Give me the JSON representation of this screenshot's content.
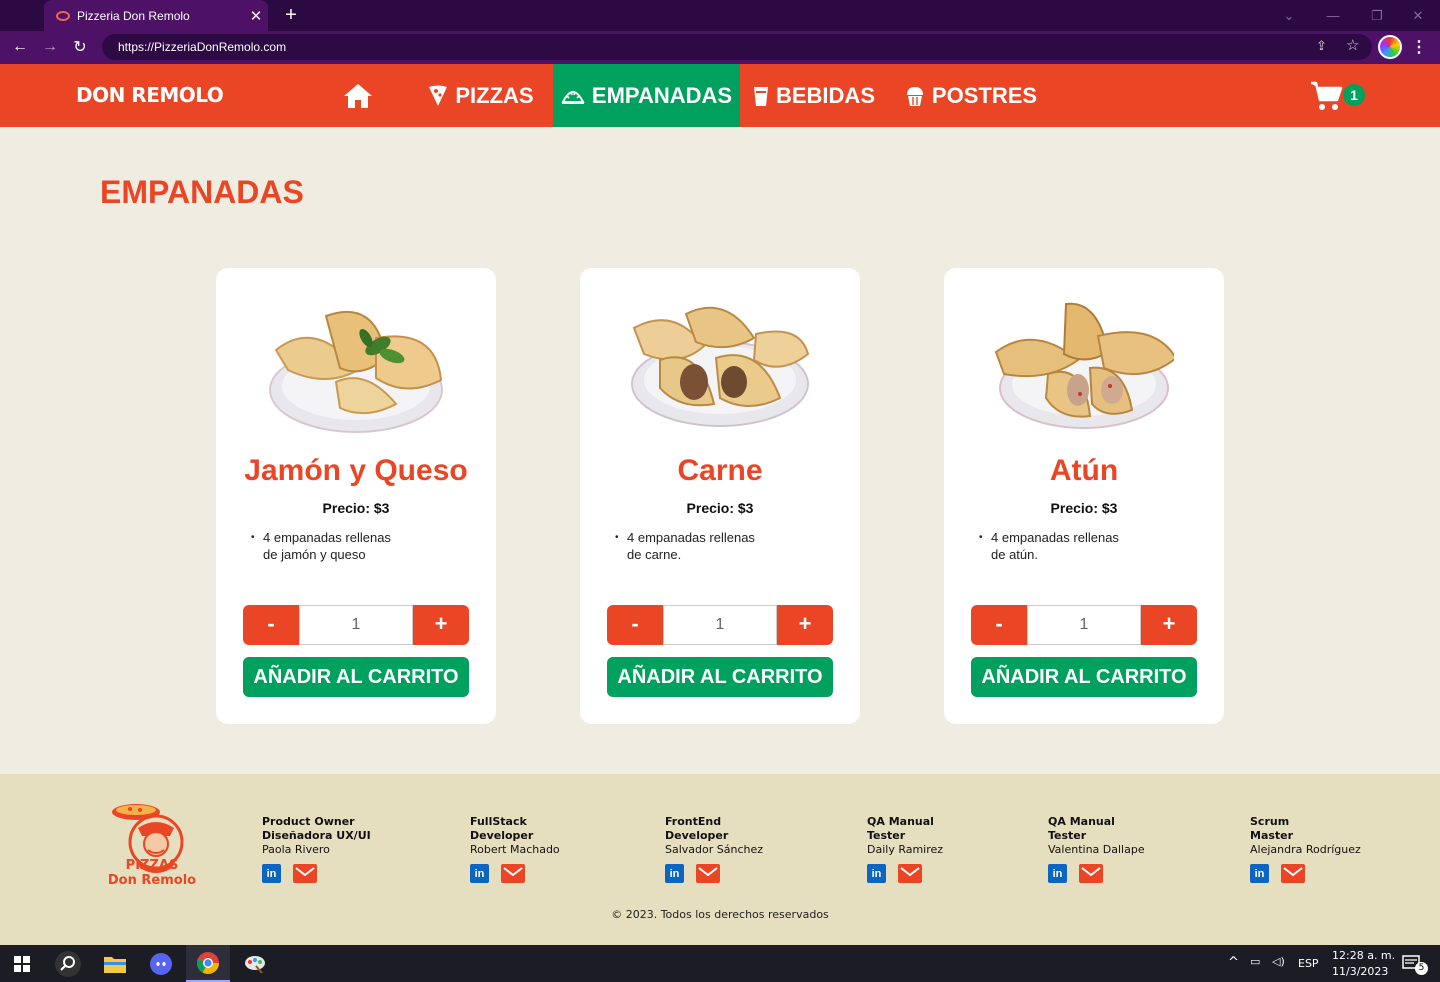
{
  "browser": {
    "tab_title": "Pizzeria Don Remolo",
    "tab_close": "✕",
    "new_tab": "+",
    "url": "https://PizzeriaDonRemolo.com"
  },
  "header": {
    "brand": "DON REMOLO",
    "nav": [
      {
        "label": "",
        "icon": "home-icon"
      },
      {
        "label": "PIZZAS",
        "icon": "pizza-slice-icon"
      },
      {
        "label": "EMPANADAS",
        "icon": "empanada-icon",
        "active": true
      },
      {
        "label": "BEBIDAS",
        "icon": "cup-icon"
      },
      {
        "label": "POSTRES",
        "icon": "cupcake-icon"
      }
    ],
    "cart_count": "1"
  },
  "main": {
    "title": "EMPANADAS",
    "products": [
      {
        "name": "Jamón y Queso",
        "price": "Precio: $3",
        "desc_line1": "4 empanadas rellenas",
        "desc_line2": "de jamón y queso",
        "qty": "1",
        "minus": "-",
        "plus": "+",
        "add": "AÑADIR AL CARRITO"
      },
      {
        "name": "Carne",
        "price": "Precio: $3",
        "desc_line1": "4 empanadas rellenas",
        "desc_line2": "de carne.",
        "qty": "1",
        "minus": "-",
        "plus": "+",
        "add": "AÑADIR AL CARRITO"
      },
      {
        "name": "Atún",
        "price": "Precio: $3",
        "desc_line1": "4 empanadas rellenas",
        "desc_line2": "de atún.",
        "qty": "1",
        "minus": "-",
        "plus": "+",
        "add": "AÑADIR AL CARRITO"
      }
    ]
  },
  "footer": {
    "logo_line1": "PIZZAS",
    "logo_line2": "Don Remolo",
    "team": [
      {
        "role": "Product Owner\nDiseñadora UX/UI",
        "name": "Paola Rivero"
      },
      {
        "role": "FullStack\nDeveloper",
        "name": "Robert Machado"
      },
      {
        "role": "FrontEnd\nDeveloper",
        "name": "Salvador Sánchez"
      },
      {
        "role": "QA Manual\nTester",
        "name": "Daily Ramirez"
      },
      {
        "role": "QA Manual\nTester",
        "name": "Valentina Dallape"
      },
      {
        "role": "Scrum\nMaster",
        "name": "Alejandra Rodríguez"
      }
    ],
    "linkedin_label": "in",
    "copyright": "© 2023. Todos los derechos reservados"
  },
  "taskbar": {
    "lang": "ESP",
    "time": "12:28 a. m.",
    "date": "11/3/2023",
    "notifications": "5"
  },
  "colors": {
    "brand_red": "#ea4626",
    "brand_green": "#00a05e",
    "page_bg": "#efede2",
    "footer_bg": "#e6dfbf",
    "browser_purple": "#4d1266"
  }
}
